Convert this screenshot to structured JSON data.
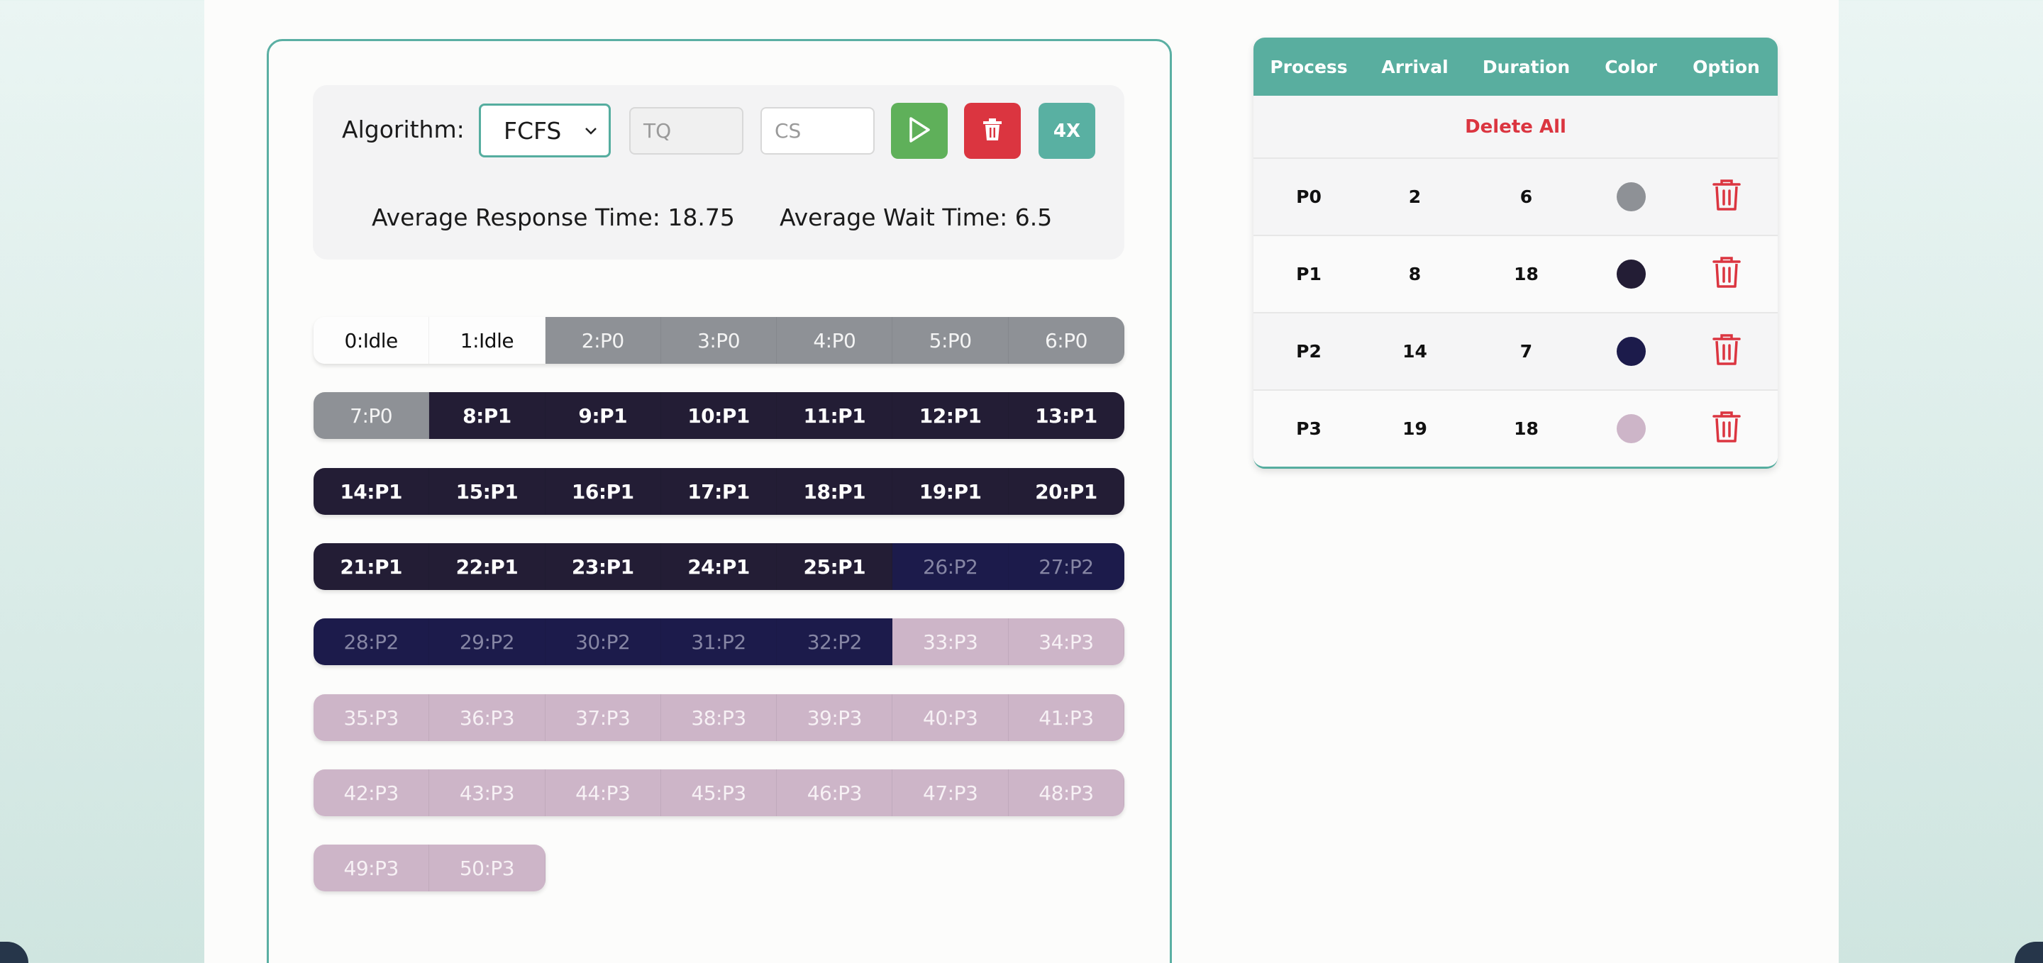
{
  "controls": {
    "algorithm_label": "Algorithm:",
    "algorithm_value": "FCFS",
    "algorithm_options": [
      "FCFS"
    ],
    "tq_placeholder": "TQ",
    "cs_placeholder": "CS",
    "speed_label": "4X",
    "play_icon": "play-icon",
    "delete_icon": "trash-icon"
  },
  "stats": {
    "avg_response": "Average Response Time: 18.75",
    "avg_wait": "Average Wait Time: 6.5"
  },
  "timeline": {
    "rows": [
      [
        {
          "t": "0:Idle",
          "p": "idle"
        },
        {
          "t": "1:Idle",
          "p": "idle"
        },
        {
          "t": "2:P0",
          "p": "p0"
        },
        {
          "t": "3:P0",
          "p": "p0"
        },
        {
          "t": "4:P0",
          "p": "p0"
        },
        {
          "t": "5:P0",
          "p": "p0"
        },
        {
          "t": "6:P0",
          "p": "p0"
        }
      ],
      [
        {
          "t": "7:P0",
          "p": "p0"
        },
        {
          "t": "8:P1",
          "p": "p1"
        },
        {
          "t": "9:P1",
          "p": "p1"
        },
        {
          "t": "10:P1",
          "p": "p1"
        },
        {
          "t": "11:P1",
          "p": "p1"
        },
        {
          "t": "12:P1",
          "p": "p1"
        },
        {
          "t": "13:P1",
          "p": "p1"
        }
      ],
      [
        {
          "t": "14:P1",
          "p": "p1"
        },
        {
          "t": "15:P1",
          "p": "p1"
        },
        {
          "t": "16:P1",
          "p": "p1"
        },
        {
          "t": "17:P1",
          "p": "p1"
        },
        {
          "t": "18:P1",
          "p": "p1"
        },
        {
          "t": "19:P1",
          "p": "p1"
        },
        {
          "t": "20:P1",
          "p": "p1"
        }
      ],
      [
        {
          "t": "21:P1",
          "p": "p1"
        },
        {
          "t": "22:P1",
          "p": "p1"
        },
        {
          "t": "23:P1",
          "p": "p1"
        },
        {
          "t": "24:P1",
          "p": "p1"
        },
        {
          "t": "25:P1",
          "p": "p1"
        },
        {
          "t": "26:P2",
          "p": "p2"
        },
        {
          "t": "27:P2",
          "p": "p2"
        }
      ],
      [
        {
          "t": "28:P2",
          "p": "p2"
        },
        {
          "t": "29:P2",
          "p": "p2"
        },
        {
          "t": "30:P2",
          "p": "p2"
        },
        {
          "t": "31:P2",
          "p": "p2"
        },
        {
          "t": "32:P2",
          "p": "p2"
        },
        {
          "t": "33:P3",
          "p": "p3"
        },
        {
          "t": "34:P3",
          "p": "p3"
        }
      ],
      [
        {
          "t": "35:P3",
          "p": "p3"
        },
        {
          "t": "36:P3",
          "p": "p3"
        },
        {
          "t": "37:P3",
          "p": "p3"
        },
        {
          "t": "38:P3",
          "p": "p3"
        },
        {
          "t": "39:P3",
          "p": "p3"
        },
        {
          "t": "40:P3",
          "p": "p3"
        },
        {
          "t": "41:P3",
          "p": "p3"
        }
      ],
      [
        {
          "t": "42:P3",
          "p": "p3"
        },
        {
          "t": "43:P3",
          "p": "p3"
        },
        {
          "t": "44:P3",
          "p": "p3"
        },
        {
          "t": "45:P3",
          "p": "p3"
        },
        {
          "t": "46:P3",
          "p": "p3"
        },
        {
          "t": "47:P3",
          "p": "p3"
        },
        {
          "t": "48:P3",
          "p": "p3"
        }
      ],
      [
        {
          "t": "49:P3",
          "p": "p3"
        },
        {
          "t": "50:P3",
          "p": "p3"
        }
      ]
    ]
  },
  "table": {
    "headers": [
      "Process",
      "Arrival",
      "Duration",
      "Color",
      "Option"
    ],
    "delete_all": "Delete All",
    "rows": [
      {
        "process": "P0",
        "arrival": "2",
        "duration": "6",
        "color": "#8e9196"
      },
      {
        "process": "P1",
        "arrival": "8",
        "duration": "18",
        "color": "#231d35"
      },
      {
        "process": "P2",
        "arrival": "14",
        "duration": "7",
        "color": "#1c1b4b"
      },
      {
        "process": "P3",
        "arrival": "19",
        "duration": "18",
        "color": "#cdb5c8"
      }
    ]
  },
  "colors": {
    "accent": "#59ae9f",
    "danger": "#db3540",
    "success": "#5fb05a"
  }
}
